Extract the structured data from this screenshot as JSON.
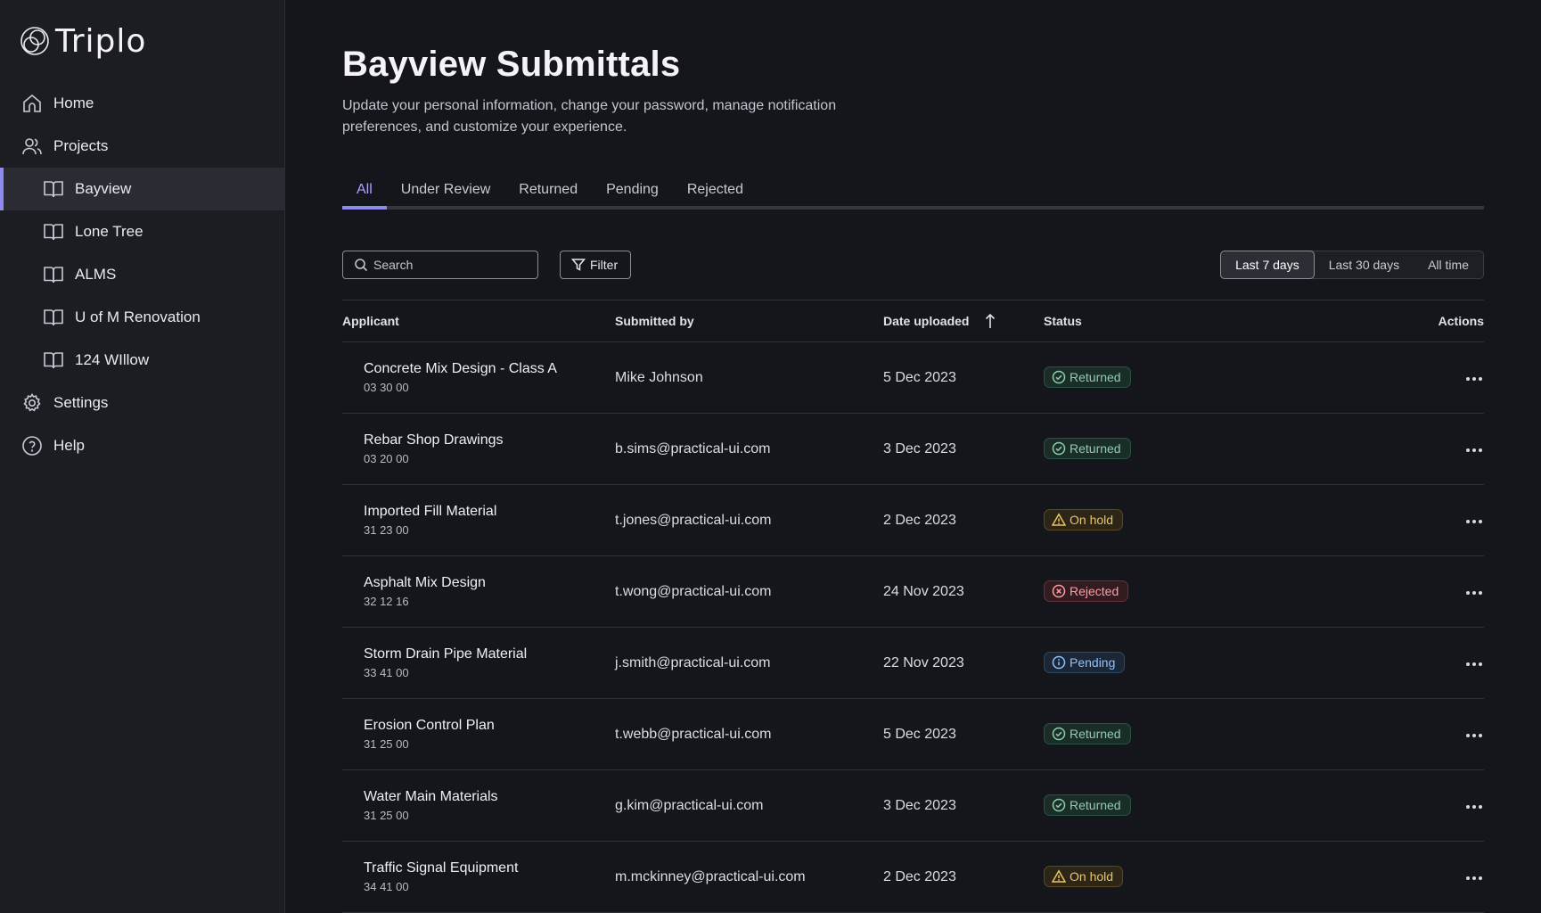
{
  "app": {
    "name": "Triplo"
  },
  "sidebar": {
    "items": [
      {
        "label": "Home",
        "icon": "home-icon"
      },
      {
        "label": "Projects",
        "icon": "users-icon"
      },
      {
        "label": "Bayview",
        "icon": "book-icon",
        "active": true
      },
      {
        "label": "Lone Tree",
        "icon": "book-icon"
      },
      {
        "label": "ALMS",
        "icon": "book-icon"
      },
      {
        "label": "U of M Renovation",
        "icon": "book-icon"
      },
      {
        "label": "124 WIllow",
        "icon": "book-icon"
      },
      {
        "label": "Settings",
        "icon": "gear-icon"
      },
      {
        "label": "Help",
        "icon": "help-icon"
      }
    ]
  },
  "page": {
    "title": "Bayview Submittals",
    "subtitle": "Update your personal information, change your password, manage notification preferences, and customize your experience."
  },
  "tabs": [
    "All",
    "Under Review",
    "Returned",
    "Pending",
    "Rejected"
  ],
  "toolbar": {
    "search_placeholder": "Search",
    "filter_label": "Filter",
    "ranges": [
      "Last 7 days",
      "Last 30 days",
      "All time"
    ],
    "active_range": "Last 7 days"
  },
  "table": {
    "headers": {
      "applicant": "Applicant",
      "submitted_by": "Submitted by",
      "date": "Date uploaded",
      "status": "Status",
      "actions": "Actions"
    },
    "rows": [
      {
        "name": "Concrete Mix Design - Class A",
        "code": "03 30 00",
        "by": "Mike Johnson",
        "date": "5 Dec 2023",
        "status": "Returned"
      },
      {
        "name": "Rebar Shop Drawings",
        "code": "03 20 00",
        "by": "b.sims@practical-ui.com",
        "date": "3 Dec 2023",
        "status": "Returned"
      },
      {
        "name": "Imported Fill Material",
        "code": "31 23 00",
        "by": "t.jones@practical-ui.com",
        "date": "2 Dec 2023",
        "status": "On hold"
      },
      {
        "name": "Asphalt Mix Design",
        "code": "32 12 16",
        "by": "t.wong@practical-ui.com",
        "date": "24 Nov 2023",
        "status": "Rejected"
      },
      {
        "name": "Storm Drain Pipe Material",
        "code": "33 41 00",
        "by": "j.smith@practical-ui.com",
        "date": "22 Nov 2023",
        "status": "Pending"
      },
      {
        "name": "Erosion Control Plan",
        "code": "31 25 00",
        "by": "t.webb@practical-ui.com",
        "date": "5 Dec 2023",
        "status": "Returned"
      },
      {
        "name": "Water Main Materials",
        "code": "31 25 00",
        "by": "g.kim@practical-ui.com",
        "date": "3 Dec 2023",
        "status": "Returned"
      },
      {
        "name": "Traffic Signal Equipment",
        "code": "34 41 00",
        "by": "m.mckinney@practical-ui.com",
        "date": "2 Dec 2023",
        "status": "On hold"
      }
    ]
  },
  "colors": {
    "accent": "#8e8af0",
    "background": "#15161b",
    "sidebar": "#1c1d23",
    "returned": "#8bd0b2",
    "on_hold": "#e9c46a",
    "rejected": "#ff9aa6",
    "pending": "#8fc1ff"
  }
}
